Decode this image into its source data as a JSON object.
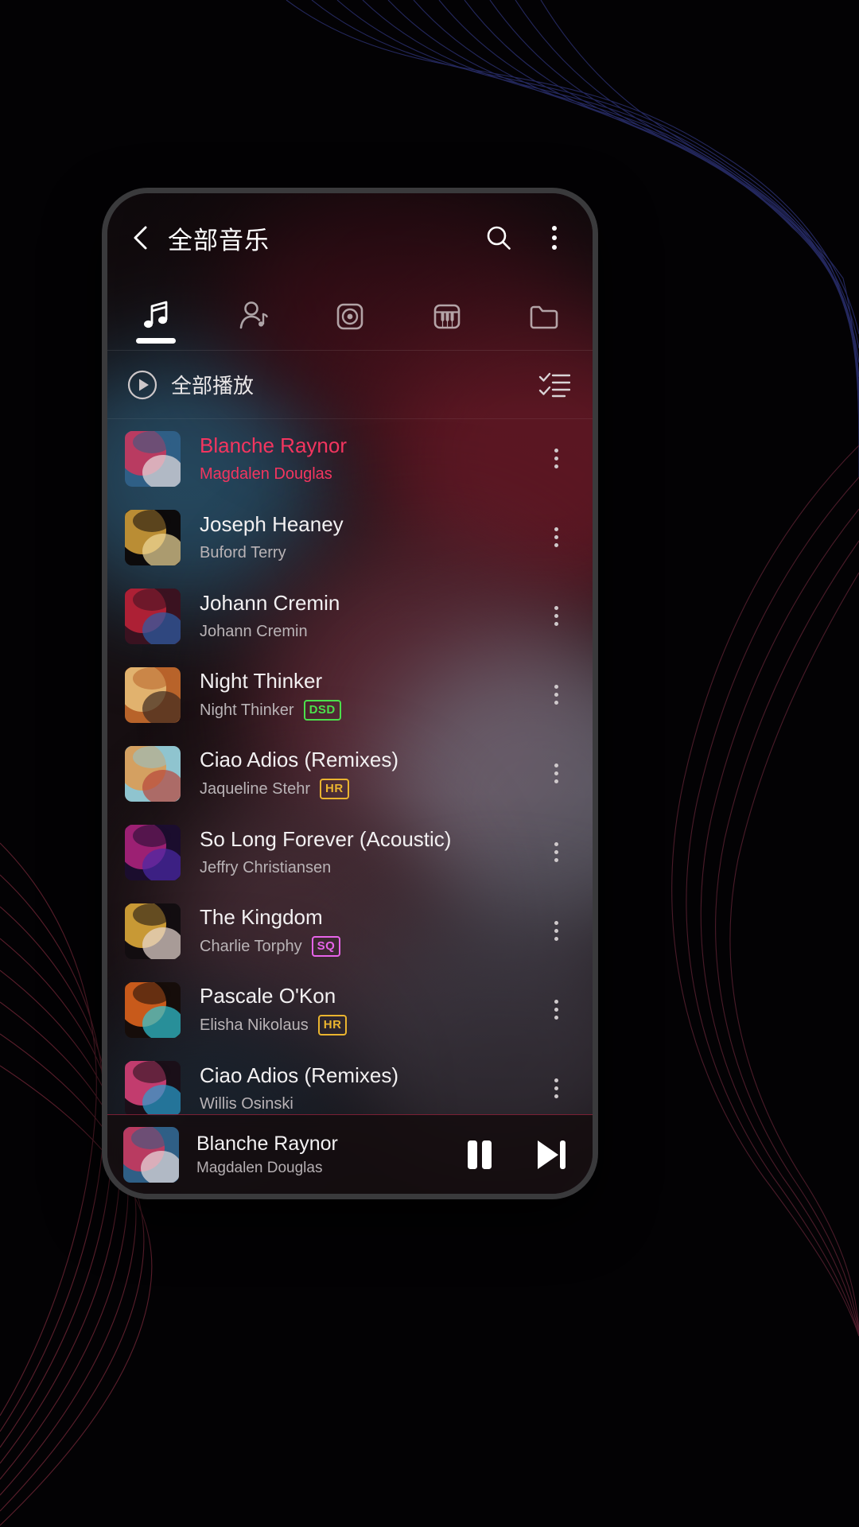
{
  "app": {
    "accent": "#f3355f",
    "header": {
      "back_icon": "chevron-left-icon",
      "title": "全部音乐",
      "search_icon": "search-icon",
      "overflow_icon": "more-vertical-icon"
    },
    "tabs": [
      {
        "id": "songs",
        "icon": "music-note-icon",
        "active": true
      },
      {
        "id": "artists",
        "icon": "artist-icon",
        "active": false
      },
      {
        "id": "albums",
        "icon": "album-disc-icon",
        "active": false
      },
      {
        "id": "genres",
        "icon": "piano-keys-icon",
        "active": false
      },
      {
        "id": "folders",
        "icon": "folder-icon",
        "active": false
      }
    ],
    "play_all": {
      "icon": "play-circle-icon",
      "label": "全部播放",
      "multiselect_icon": "checklist-icon"
    },
    "songs": [
      {
        "title": "Blanche Raynor",
        "artist": "Magdalen Douglas",
        "badge": "",
        "playing": true,
        "art": [
          "#2f5f86",
          "#d1355a",
          "#e8dfe0"
        ]
      },
      {
        "title": "Joseph Heaney",
        "artist": "Buford Terry",
        "badge": "",
        "playing": false,
        "art": [
          "#0c0a0b",
          "#d9a43c",
          "#f0d89a"
        ]
      },
      {
        "title": "Johann Cremin",
        "artist": "Johann Cremin",
        "badge": "",
        "playing": false,
        "art": [
          "#3a1220",
          "#c2233a",
          "#2b5ea8"
        ]
      },
      {
        "title": "Night Thinker",
        "artist": "Night Thinker",
        "badge": "DSD",
        "playing": false,
        "art": [
          "#b8632a",
          "#e8c07a",
          "#3d2a20"
        ]
      },
      {
        "title": "Ciao Adios (Remixes)",
        "artist": "Jaqueline Stehr",
        "badge": "HR",
        "playing": false,
        "art": [
          "#8fc4cf",
          "#e09a4e",
          "#b8463a"
        ]
      },
      {
        "title": "So Long Forever (Acoustic)",
        "artist": "Jeffry Christiansen",
        "badge": "",
        "playing": false,
        "art": [
          "#1b0d2e",
          "#b3257f",
          "#4a2aa8"
        ]
      },
      {
        "title": "The Kingdom",
        "artist": "Charlie Torphy",
        "badge": "SQ",
        "playing": false,
        "art": [
          "#120d10",
          "#e9b33c",
          "#e8d9d2"
        ]
      },
      {
        "title": "Pascale O'Kon",
        "artist": "Elisha Nikolaus",
        "badge": "HR",
        "playing": false,
        "art": [
          "#160d0a",
          "#e8691f",
          "#31c8d6"
        ]
      },
      {
        "title": "Ciao Adios (Remixes)",
        "artist": "Willis Osinski",
        "badge": "",
        "playing": false,
        "art": [
          "#1a0f18",
          "#e0447e",
          "#2a9fd0"
        ]
      }
    ],
    "mini_player": {
      "title": "Blanche Raynor",
      "artist": "Magdalen Douglas",
      "pause_icon": "pause-icon",
      "next_icon": "skip-next-icon",
      "art": [
        "#2f5f86",
        "#d1355a",
        "#e8dfe0"
      ]
    }
  }
}
